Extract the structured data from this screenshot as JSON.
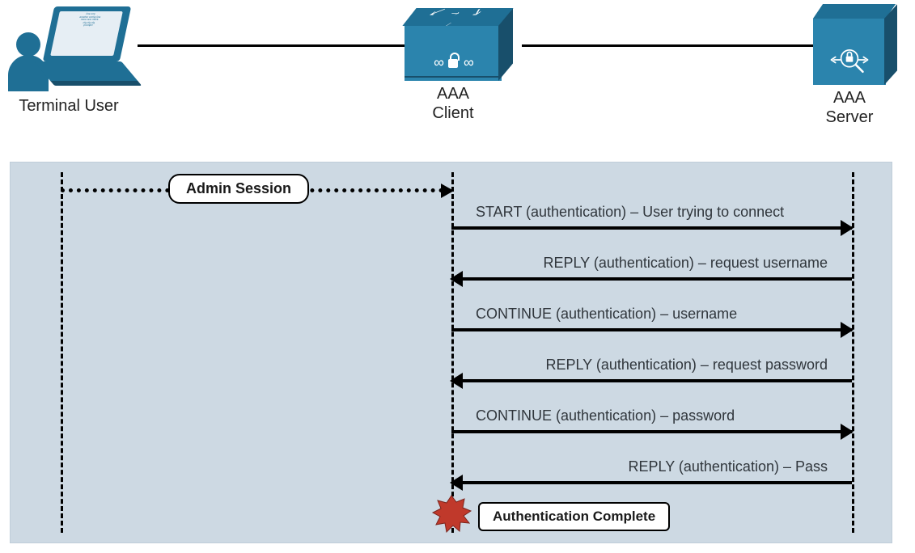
{
  "nodes": {
    "terminal": {
      "label": "Terminal User"
    },
    "client": {
      "label_l1": "AAA",
      "label_l2": "Client"
    },
    "server": {
      "label_l1": "AAA",
      "label_l2": "Server"
    }
  },
  "session_pill": "Admin Session",
  "messages": [
    {
      "dir": "right",
      "text": "START (authentication) – User trying to connect"
    },
    {
      "dir": "left",
      "text": "REPLY (authentication) – request username"
    },
    {
      "dir": "right",
      "text": "CONTINUE (authentication) – username"
    },
    {
      "dir": "left",
      "text": "REPLY (authentication) – request password"
    },
    {
      "dir": "right",
      "text": "CONTINUE (authentication) – password"
    },
    {
      "dir": "left",
      "text": "REPLY (authentication) – Pass"
    }
  ],
  "complete_badge": "Authentication Complete",
  "colors": {
    "brand": "#1f6f95",
    "panel": "#cdd9e3",
    "badge": "#c0392b"
  }
}
